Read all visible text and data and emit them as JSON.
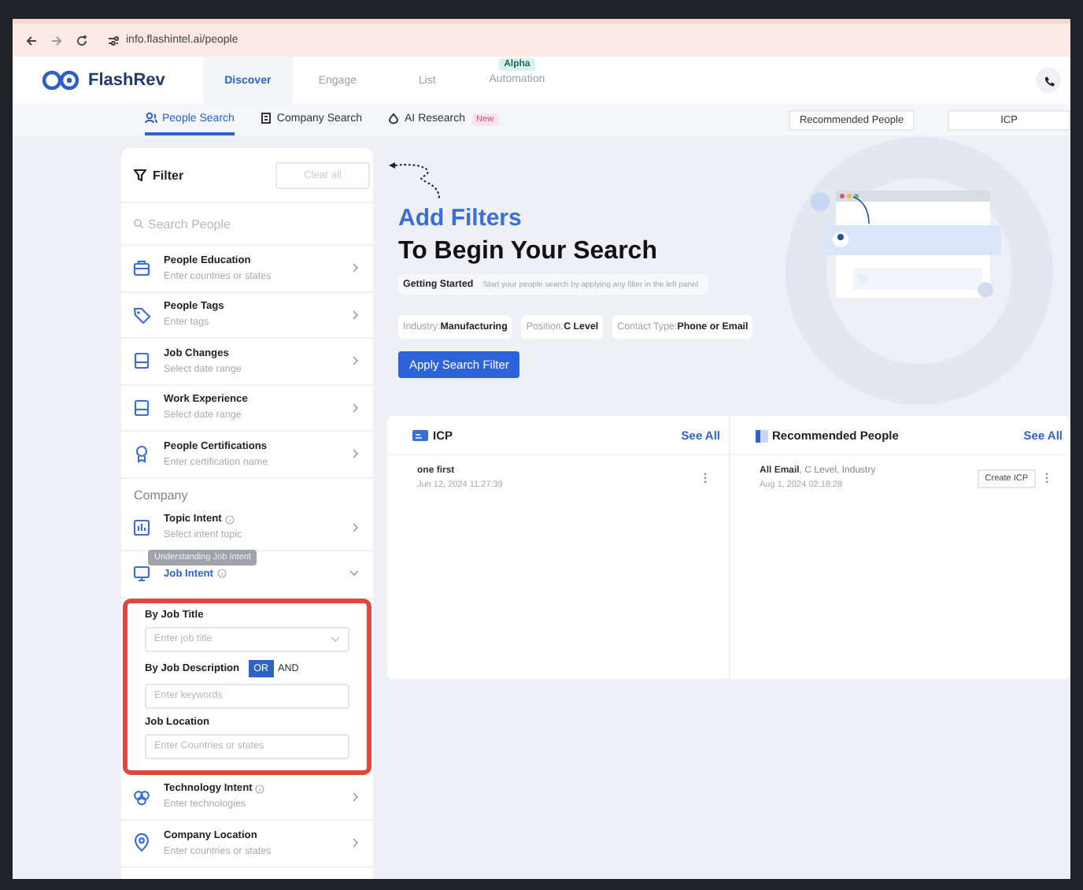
{
  "browser": {
    "url": "info.flashintel.ai/people"
  },
  "header": {
    "logo": "FlashRev",
    "tabs": [
      {
        "label": "Discover",
        "selected": true
      },
      {
        "label": "Engage",
        "selected": false
      },
      {
        "label": "List",
        "selected": false
      },
      {
        "label": "Automation",
        "selected": false,
        "badge": "Alpha"
      }
    ]
  },
  "subnav": {
    "tabs": [
      {
        "label": "People Search",
        "selected": true
      },
      {
        "label": "Company Search",
        "selected": false
      },
      {
        "label": "AI Research",
        "selected": false,
        "badge": "New"
      }
    ],
    "buttons": [
      "Recommended People",
      "ICP"
    ]
  },
  "filter": {
    "title": "Filter",
    "clear": "Clear all",
    "search_placeholder": "Search People",
    "groups": [
      {
        "items": [
          {
            "title": "People Education",
            "hint": "Enter countries or states",
            "info": false,
            "expanded": false
          },
          {
            "title": "People Tags",
            "hint": "Enter tags",
            "info": false,
            "expanded": false
          },
          {
            "title": "Job Changes",
            "hint": "Select date range",
            "info": false,
            "expanded": false
          },
          {
            "title": "Work Experience",
            "hint": "Select date range",
            "info": false,
            "expanded": false
          },
          {
            "title": "People Certifications",
            "hint": "Enter certification name",
            "info": false,
            "expanded": false
          }
        ]
      },
      {
        "heading": "Company",
        "items": [
          {
            "title": "Topic Intent",
            "hint": "Select intent topic",
            "info": true,
            "expanded": false
          },
          {
            "title": "Job Intent",
            "info": true,
            "expanded": true,
            "tooltip": "Understanding Job Intent",
            "panel": {
              "highlighted": true,
              "fields": [
                {
                  "kind": "select",
                  "label": "By Job Title",
                  "placeholder": "Enter job title"
                },
                {
                  "kind": "text",
                  "label": "By Job Description",
                  "placeholder": "Enter keywords",
                  "options": [
                    {
                      "label": "OR",
                      "selected": true
                    },
                    {
                      "label": "AND",
                      "selected": false
                    }
                  ]
                },
                {
                  "kind": "text",
                  "label": "Job Location",
                  "placeholder": "Enter Countries or states"
                }
              ]
            }
          },
          {
            "title": "Technology Intent",
            "hint": "Enter technologies",
            "info": true,
            "expanded": false
          },
          {
            "title": "Company Location",
            "hint": "Enter countries or states",
            "info": false,
            "expanded": false
          }
        ]
      }
    ]
  },
  "hero": {
    "title": "Add Filters",
    "subtitle": "To Begin Your Search",
    "tip": {
      "label": "Getting Started",
      "text": "Start your people search by applying any filter in the left panel"
    },
    "chips": [
      {
        "label": "Industry:",
        "value": "Manufacturing"
      },
      {
        "label": "Position:",
        "value": "C Level"
      },
      {
        "label": "Contact Type:",
        "value": "Phone or Email"
      }
    ],
    "button": "Apply Search Filter"
  },
  "cards": [
    {
      "title": "ICP",
      "link": "See All",
      "rows": [
        {
          "name": "one first",
          "date": "Jun 12, 2024 11:27:39"
        }
      ]
    },
    {
      "title": "Recommended People",
      "link": "See All",
      "rows": [
        {
          "name": "All Email",
          "detail": ", C Level, Industry",
          "date": "Aug 1, 2024 02:18:28",
          "action": "Create ICP"
        }
      ]
    }
  ]
}
